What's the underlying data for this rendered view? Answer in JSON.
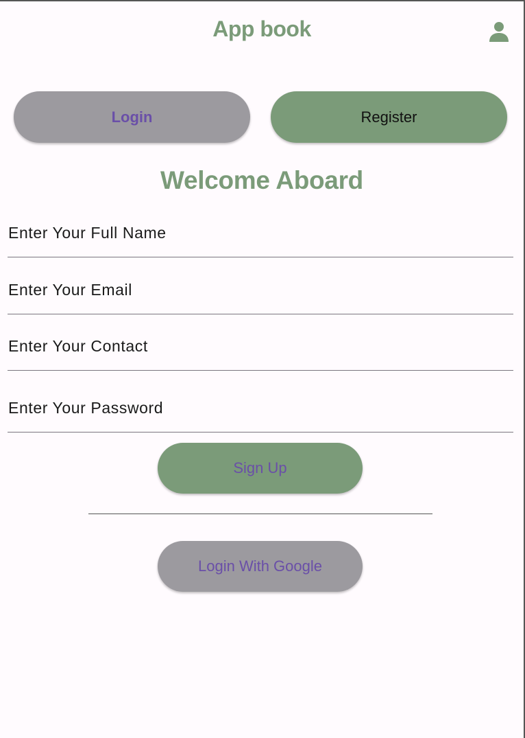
{
  "app_bar": {
    "title": "App book",
    "profile_icon": "person-icon"
  },
  "tabs": {
    "login_label": "Login",
    "register_label": "Register"
  },
  "heading": "Welcome Aboard",
  "form": {
    "full_name_label": "Enter Your Full Name",
    "email_label": "Enter Your Email",
    "contact_label": "Enter Your Contact",
    "password_label": "Enter Your Password"
  },
  "actions": {
    "signup_label": "Sign Up",
    "google_label": "Login With Google"
  },
  "colors": {
    "accent_green": "#7b9b79",
    "button_gray": "#9c9a9f",
    "button_text_purple": "#6a4fa8",
    "background": "#fffbfe"
  }
}
